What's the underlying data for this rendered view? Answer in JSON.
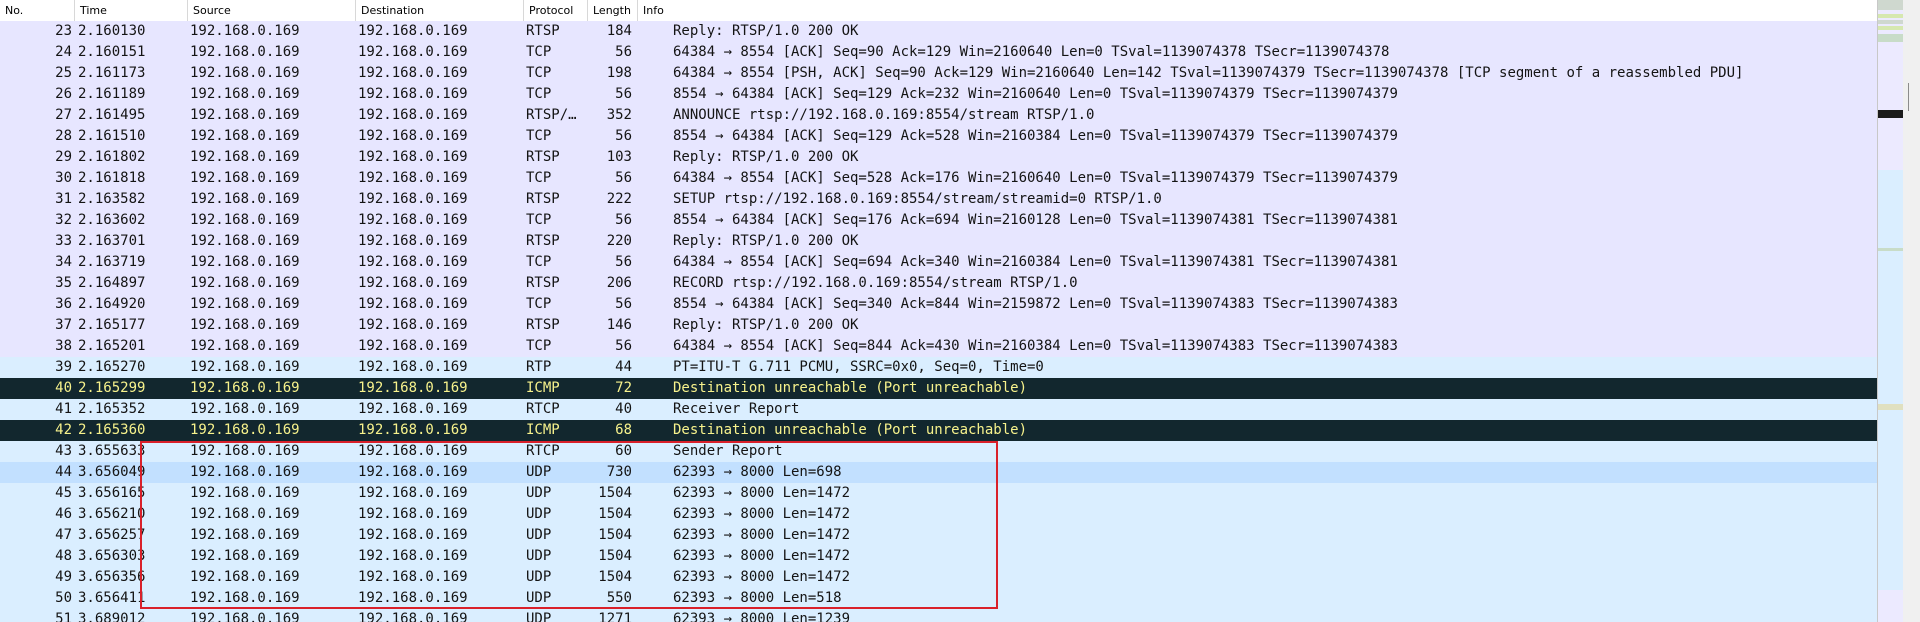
{
  "columns": {
    "no": "No.",
    "time": "Time",
    "source": "Source",
    "destination": "Destination",
    "protocol": "Protocol",
    "length": "Length",
    "info": "Info"
  },
  "colors": {
    "tcp_bg": "#e7e6ff",
    "udp_bg": "#daeeff",
    "selected_bg": "#c2e0ff",
    "error_bg": "#12272e",
    "error_fg": "#f7f28c",
    "highlight_box": "#d9202a"
  },
  "packets": [
    {
      "no": "23",
      "time": "2.160130",
      "source": "192.168.0.169",
      "destination": "192.168.0.169",
      "protocol": "RTSP",
      "length": "184",
      "info": "Reply: RTSP/1.0 200 OK",
      "style": "tcp"
    },
    {
      "no": "24",
      "time": "2.160151",
      "source": "192.168.0.169",
      "destination": "192.168.0.169",
      "protocol": "TCP",
      "length": "56",
      "info": "64384 → 8554 [ACK] Seq=90 Ack=129 Win=2160640 Len=0 TSval=1139074378 TSecr=1139074378",
      "style": "tcp"
    },
    {
      "no": "25",
      "time": "2.161173",
      "source": "192.168.0.169",
      "destination": "192.168.0.169",
      "protocol": "TCP",
      "length": "198",
      "info": "64384 → 8554 [PSH, ACK] Seq=90 Ack=129 Win=2160640 Len=142 TSval=1139074379 TSecr=1139074378 [TCP segment of a reassembled PDU]",
      "style": "tcp"
    },
    {
      "no": "26",
      "time": "2.161189",
      "source": "192.168.0.169",
      "destination": "192.168.0.169",
      "protocol": "TCP",
      "length": "56",
      "info": "8554 → 64384 [ACK] Seq=129 Ack=232 Win=2160640 Len=0 TSval=1139074379 TSecr=1139074379",
      "style": "tcp"
    },
    {
      "no": "27",
      "time": "2.161495",
      "source": "192.168.0.169",
      "destination": "192.168.0.169",
      "protocol": "RTSP/…",
      "length": "352",
      "info": "ANNOUNCE rtsp://192.168.0.169:8554/stream RTSP/1.0",
      "style": "tcp"
    },
    {
      "no": "28",
      "time": "2.161510",
      "source": "192.168.0.169",
      "destination": "192.168.0.169",
      "protocol": "TCP",
      "length": "56",
      "info": "8554 → 64384 [ACK] Seq=129 Ack=528 Win=2160384 Len=0 TSval=1139074379 TSecr=1139074379",
      "style": "tcp"
    },
    {
      "no": "29",
      "time": "2.161802",
      "source": "192.168.0.169",
      "destination": "192.168.0.169",
      "protocol": "RTSP",
      "length": "103",
      "info": "Reply: RTSP/1.0 200 OK",
      "style": "tcp"
    },
    {
      "no": "30",
      "time": "2.161818",
      "source": "192.168.0.169",
      "destination": "192.168.0.169",
      "protocol": "TCP",
      "length": "56",
      "info": "64384 → 8554 [ACK] Seq=528 Ack=176 Win=2160640 Len=0 TSval=1139074379 TSecr=1139074379",
      "style": "tcp"
    },
    {
      "no": "31",
      "time": "2.163582",
      "source": "192.168.0.169",
      "destination": "192.168.0.169",
      "protocol": "RTSP",
      "length": "222",
      "info": "SETUP rtsp://192.168.0.169:8554/stream/streamid=0 RTSP/1.0",
      "style": "tcp"
    },
    {
      "no": "32",
      "time": "2.163602",
      "source": "192.168.0.169",
      "destination": "192.168.0.169",
      "protocol": "TCP",
      "length": "56",
      "info": "8554 → 64384 [ACK] Seq=176 Ack=694 Win=2160128 Len=0 TSval=1139074381 TSecr=1139074381",
      "style": "tcp"
    },
    {
      "no": "33",
      "time": "2.163701",
      "source": "192.168.0.169",
      "destination": "192.168.0.169",
      "protocol": "RTSP",
      "length": "220",
      "info": "Reply: RTSP/1.0 200 OK",
      "style": "tcp"
    },
    {
      "no": "34",
      "time": "2.163719",
      "source": "192.168.0.169",
      "destination": "192.168.0.169",
      "protocol": "TCP",
      "length": "56",
      "info": "64384 → 8554 [ACK] Seq=694 Ack=340 Win=2160384 Len=0 TSval=1139074381 TSecr=1139074381",
      "style": "tcp"
    },
    {
      "no": "35",
      "time": "2.164897",
      "source": "192.168.0.169",
      "destination": "192.168.0.169",
      "protocol": "RTSP",
      "length": "206",
      "info": "RECORD rtsp://192.168.0.169:8554/stream RTSP/1.0",
      "style": "tcp"
    },
    {
      "no": "36",
      "time": "2.164920",
      "source": "192.168.0.169",
      "destination": "192.168.0.169",
      "protocol": "TCP",
      "length": "56",
      "info": "8554 → 64384 [ACK] Seq=340 Ack=844 Win=2159872 Len=0 TSval=1139074383 TSecr=1139074383",
      "style": "tcp"
    },
    {
      "no": "37",
      "time": "2.165177",
      "source": "192.168.0.169",
      "destination": "192.168.0.169",
      "protocol": "RTSP",
      "length": "146",
      "info": "Reply: RTSP/1.0 200 OK",
      "style": "tcp"
    },
    {
      "no": "38",
      "time": "2.165201",
      "source": "192.168.0.169",
      "destination": "192.168.0.169",
      "protocol": "TCP",
      "length": "56",
      "info": "64384 → 8554 [ACK] Seq=844 Ack=430 Win=2160384 Len=0 TSval=1139074383 TSecr=1139074383",
      "style": "tcp"
    },
    {
      "no": "39",
      "time": "2.165270",
      "source": "192.168.0.169",
      "destination": "192.168.0.169",
      "protocol": "RTP",
      "length": "44",
      "info": "PT=ITU-T G.711 PCMU, SSRC=0x0, Seq=0, Time=0",
      "style": "udp"
    },
    {
      "no": "40",
      "time": "2.165299",
      "source": "192.168.0.169",
      "destination": "192.168.0.169",
      "protocol": "ICMP",
      "length": "72",
      "info": "Destination unreachable (Port unreachable)",
      "style": "err"
    },
    {
      "no": "41",
      "time": "2.165352",
      "source": "192.168.0.169",
      "destination": "192.168.0.169",
      "protocol": "RTCP",
      "length": "40",
      "info": "Receiver Report",
      "style": "udp"
    },
    {
      "no": "42",
      "time": "2.165360",
      "source": "192.168.0.169",
      "destination": "192.168.0.169",
      "protocol": "ICMP",
      "length": "68",
      "info": "Destination unreachable (Port unreachable)",
      "style": "err"
    },
    {
      "no": "43",
      "time": "3.655633",
      "source": "192.168.0.169",
      "destination": "192.168.0.169",
      "protocol": "RTCP",
      "length": "60",
      "info": "Sender Report",
      "style": "udp"
    },
    {
      "no": "44",
      "time": "3.656049",
      "source": "192.168.0.169",
      "destination": "192.168.0.169",
      "protocol": "UDP",
      "length": "730",
      "info": "62393 → 8000 Len=698",
      "style": "sel"
    },
    {
      "no": "45",
      "time": "3.656165",
      "source": "192.168.0.169",
      "destination": "192.168.0.169",
      "protocol": "UDP",
      "length": "1504",
      "info": "62393 → 8000 Len=1472",
      "style": "udp"
    },
    {
      "no": "46",
      "time": "3.656210",
      "source": "192.168.0.169",
      "destination": "192.168.0.169",
      "protocol": "UDP",
      "length": "1504",
      "info": "62393 → 8000 Len=1472",
      "style": "udp"
    },
    {
      "no": "47",
      "time": "3.656257",
      "source": "192.168.0.169",
      "destination": "192.168.0.169",
      "protocol": "UDP",
      "length": "1504",
      "info": "62393 → 8000 Len=1472",
      "style": "udp"
    },
    {
      "no": "48",
      "time": "3.656303",
      "source": "192.168.0.169",
      "destination": "192.168.0.169",
      "protocol": "UDP",
      "length": "1504",
      "info": "62393 → 8000 Len=1472",
      "style": "udp"
    },
    {
      "no": "49",
      "time": "3.656356",
      "source": "192.168.0.169",
      "destination": "192.168.0.169",
      "protocol": "UDP",
      "length": "1504",
      "info": "62393 → 8000 Len=1472",
      "style": "udp"
    },
    {
      "no": "50",
      "time": "3.656411",
      "source": "192.168.0.169",
      "destination": "192.168.0.169",
      "protocol": "UDP",
      "length": "550",
      "info": "62393 → 8000 Len=518",
      "style": "udp"
    },
    {
      "no": "51",
      "time": "3.689012",
      "source": "192.168.0.169",
      "destination": "192.168.0.169",
      "protocol": "UDP",
      "length": "1271",
      "info": "62393 → 8000 Len=1239",
      "style": "udp"
    }
  ]
}
